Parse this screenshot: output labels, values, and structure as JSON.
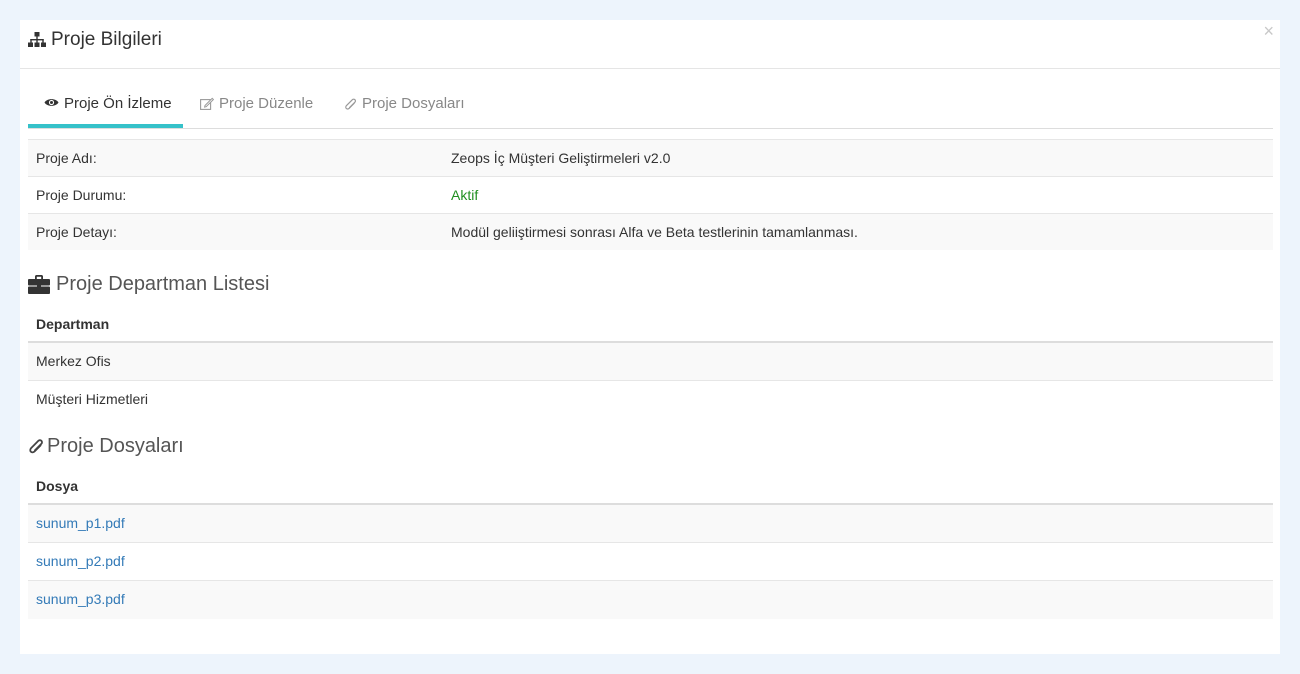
{
  "modal": {
    "title": "Proje Bilgileri",
    "close_label": "×",
    "icon": "sitemap-icon"
  },
  "tabs": [
    {
      "label": "Proje Ön İzleme",
      "icon": "eye-icon",
      "active": true
    },
    {
      "label": "Proje Düzenle",
      "icon": "edit-icon",
      "active": false
    },
    {
      "label": "Proje Dosyaları",
      "icon": "paperclip-icon",
      "active": false
    }
  ],
  "info": [
    {
      "label": "Proje Adı:",
      "value": "Zeops İç Müşteri Geliştirmeleri v2.0"
    },
    {
      "label": "Proje Durumu:",
      "value": "Aktif"
    },
    {
      "label": "Proje Detayı:",
      "value": "Modül geliiştirmesi sonrası Alfa ve Beta testlerinin tamamlanması."
    }
  ],
  "departments": {
    "title": "Proje Departman Listesi",
    "icon": "briefcase-icon",
    "header": "Departman",
    "items": [
      "Merkez Ofis",
      "Müşteri Hizmetleri"
    ]
  },
  "files": {
    "title": "Proje Dosyaları",
    "icon": "paperclip-icon",
    "header": "Dosya",
    "items": [
      "sunum_p1.pdf",
      "sunum_p2.pdf",
      "sunum_p3.pdf"
    ]
  },
  "colors": {
    "accent": "#35c1c9",
    "status_active": "#1f8f1f",
    "link": "#337ab7",
    "backdrop": "#edf4fc"
  }
}
